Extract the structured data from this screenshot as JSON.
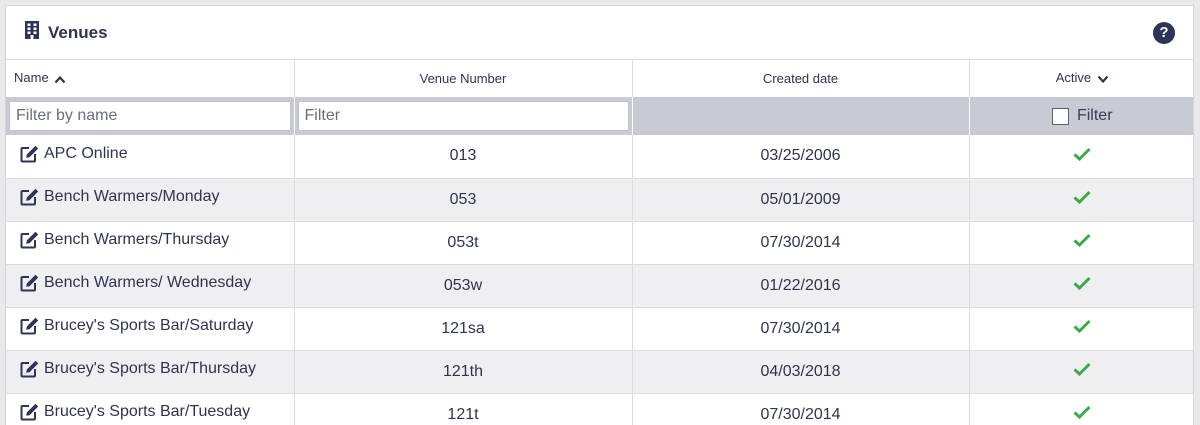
{
  "panel": {
    "title": "Venues",
    "title_icon": "building-icon",
    "help_icon": "question-circle-icon",
    "help_label": "?"
  },
  "columns": [
    {
      "label": "Name",
      "sort": "asc"
    },
    {
      "label": "Venue Number"
    },
    {
      "label": "Created date"
    },
    {
      "label": "Active",
      "sort": "desc"
    }
  ],
  "filters": {
    "name_placeholder": "Filter by name",
    "number_placeholder": "Filter",
    "active_label": "Filter"
  },
  "colors": {
    "accent": "#2e3358",
    "check": "#3daa4a",
    "filter_bg": "#c8cad4",
    "stripe": "#efeff1"
  },
  "rows": [
    {
      "name": "APC Online",
      "number": "013",
      "created": "03/25/2006",
      "active": true
    },
    {
      "name": "Bench Warmers/Monday",
      "number": "053",
      "created": "05/01/2009",
      "active": true
    },
    {
      "name": "Bench Warmers/Thursday",
      "number": "053t",
      "created": "07/30/2014",
      "active": true
    },
    {
      "name": "Bench Warmers/ Wednesday",
      "number": "053w",
      "created": "01/22/2016",
      "active": true
    },
    {
      "name": "Brucey's Sports Bar/Saturday",
      "number": "121sa",
      "created": "07/30/2014",
      "active": true
    },
    {
      "name": "Brucey's Sports Bar/Thursday",
      "number": "121th",
      "created": "04/03/2018",
      "active": true
    },
    {
      "name": "Brucey's Sports Bar/Tuesday",
      "number": "121t",
      "created": "07/30/2014",
      "active": true
    }
  ]
}
